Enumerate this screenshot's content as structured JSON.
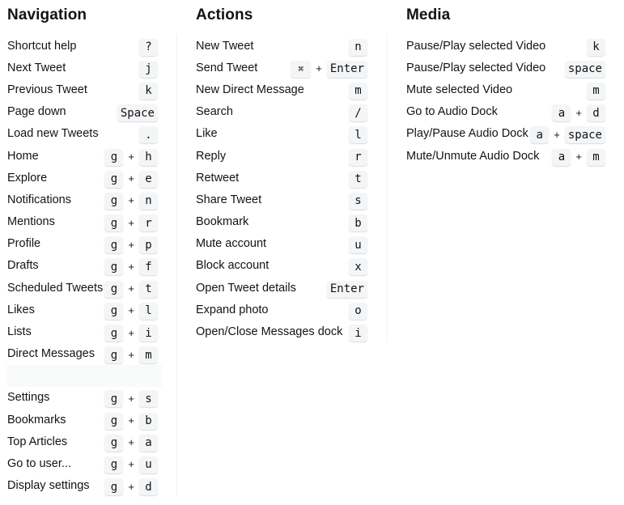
{
  "columns": {
    "navigation": {
      "title": "Navigation",
      "items": [
        {
          "label": "Shortcut help",
          "keys": [
            "?"
          ]
        },
        {
          "label": "Next Tweet",
          "keys": [
            "j"
          ]
        },
        {
          "label": "Previous Tweet",
          "keys": [
            "k"
          ]
        },
        {
          "label": "Page down",
          "keys": [
            "Space"
          ]
        },
        {
          "label": "Load new Tweets",
          "keys": [
            "."
          ]
        },
        {
          "label": "Home",
          "keys": [
            "g",
            "h"
          ]
        },
        {
          "label": "Explore",
          "keys": [
            "g",
            "e"
          ]
        },
        {
          "label": "Notifications",
          "keys": [
            "g",
            "n"
          ]
        },
        {
          "label": "Mentions",
          "keys": [
            "g",
            "r"
          ]
        },
        {
          "label": "Profile",
          "keys": [
            "g",
            "p"
          ]
        },
        {
          "label": "Drafts",
          "keys": [
            "g",
            "f"
          ]
        },
        {
          "label": "Scheduled Tweets",
          "keys": [
            "g",
            "t"
          ]
        },
        {
          "label": "Likes",
          "keys": [
            "g",
            "l"
          ]
        },
        {
          "label": "Lists",
          "keys": [
            "g",
            "i"
          ]
        },
        {
          "label": "Direct Messages",
          "keys": [
            "g",
            "m"
          ]
        },
        {
          "spacer": true
        },
        {
          "label": "Settings",
          "keys": [
            "g",
            "s"
          ]
        },
        {
          "label": "Bookmarks",
          "keys": [
            "g",
            "b"
          ]
        },
        {
          "label": "Top Articles",
          "keys": [
            "g",
            "a"
          ]
        },
        {
          "label": "Go to user...",
          "keys": [
            "g",
            "u"
          ]
        },
        {
          "label": "Display settings",
          "keys": [
            "g",
            "d"
          ]
        }
      ]
    },
    "actions": {
      "title": "Actions",
      "items": [
        {
          "label": "New Tweet",
          "keys": [
            "n"
          ]
        },
        {
          "label": "Send Tweet",
          "keys": [
            "⌘",
            "Enter"
          ]
        },
        {
          "label": "New Direct Message",
          "keys": [
            "m"
          ]
        },
        {
          "label": "Search",
          "keys": [
            "/"
          ]
        },
        {
          "label": "Like",
          "keys": [
            "l"
          ]
        },
        {
          "label": "Reply",
          "keys": [
            "r"
          ]
        },
        {
          "label": "Retweet",
          "keys": [
            "t"
          ]
        },
        {
          "label": "Share Tweet",
          "keys": [
            "s"
          ]
        },
        {
          "label": "Bookmark",
          "keys": [
            "b"
          ]
        },
        {
          "label": "Mute account",
          "keys": [
            "u"
          ]
        },
        {
          "label": "Block account",
          "keys": [
            "x"
          ]
        },
        {
          "label": "Open Tweet details",
          "keys": [
            "Enter"
          ]
        },
        {
          "label": "Expand photo",
          "keys": [
            "o"
          ]
        },
        {
          "label": "Open/Close Messages dock",
          "keys": [
            "i"
          ]
        }
      ]
    },
    "media": {
      "title": "Media",
      "items": [
        {
          "label": "Pause/Play selected Video",
          "keys": [
            "k"
          ]
        },
        {
          "label": "Pause/Play selected Video",
          "keys": [
            "space"
          ]
        },
        {
          "label": "Mute selected Video",
          "keys": [
            "m"
          ]
        },
        {
          "label": "Go to Audio Dock",
          "keys": [
            "a",
            "d"
          ]
        },
        {
          "label": "Play/Pause Audio Dock",
          "keys": [
            "a",
            "space"
          ]
        },
        {
          "label": "Mute/Unmute Audio Dock",
          "keys": [
            "a",
            "m"
          ]
        }
      ]
    }
  },
  "key_separator": "+",
  "colors": {
    "text": "#0f1419",
    "key_background": "#f4f5f6",
    "divider": "#eff1f3"
  }
}
